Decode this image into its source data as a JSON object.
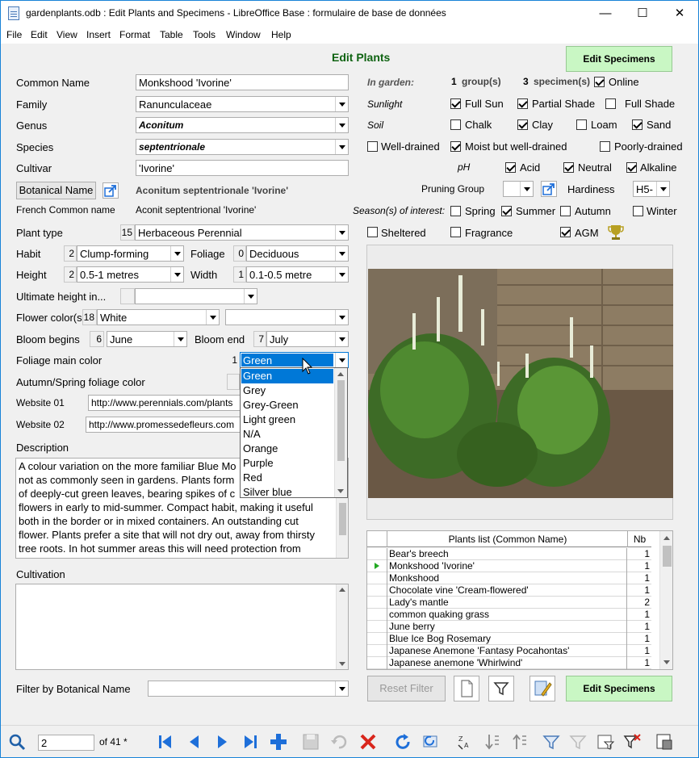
{
  "window": {
    "title": "gardenplants.odb : Edit Plants and Specimens - LibreOffice Base : formulaire de base de données",
    "minimize": "—",
    "maximize": "☐",
    "close": "✕"
  },
  "menu": [
    "File",
    "Edit",
    "View",
    "Insert",
    "Format",
    "Table",
    "Tools",
    "Window",
    "Help"
  ],
  "form": {
    "title": "Edit Plants",
    "edit_specimens_label": "Edit Specimens",
    "common_name_label": "Common Name",
    "common_name_value": "Monkshood 'Ivorine'",
    "family_label": "Family",
    "family_value": "Ranunculaceae",
    "genus_label": "Genus",
    "genus_value": "Aconitum",
    "species_label": "Species",
    "species_value": "septentrionale",
    "cultivar_label": "Cultivar",
    "cultivar_value": "'Ivorine'",
    "botanical_name_button": "Botanical Name",
    "botanical_name_value": "Aconitum septentrionale 'Ivorine'",
    "french_label": "French Common name",
    "french_value": "Aconit septentrional 'Ivorine'",
    "plant_type_label": "Plant type",
    "plant_type_num": "15",
    "plant_type_value": "Herbaceous Perennial",
    "habit_label": "Habit",
    "habit_num": "2",
    "habit_value": "Clump-forming",
    "foliage_label": "Foliage",
    "foliage_num": "0",
    "foliage_value": "Deciduous",
    "height_label": "Height",
    "height_num": "2",
    "height_value": "0.5-1 metres",
    "width_label": "Width",
    "width_num": "1",
    "width_value": "0.1-0.5 metre",
    "ultimate_label": "Ultimate height in...",
    "flower_label": "Flower color(s",
    "flower_num": "18",
    "flower_value": "White",
    "bloom_begins_label": "Bloom begins",
    "bloom_begins_num": "6",
    "bloom_begins_value": "June",
    "bloom_end_label": "Bloom end",
    "bloom_end_num": "7",
    "bloom_end_value": "July",
    "foliage_main_label": "Foliage main color",
    "foliage_main_num": "1",
    "foliage_main_value": "Green",
    "autumn_label": "Autumn/Spring foliage color",
    "website1_label": "Website 01",
    "website1_value": "http://www.perennials.com/plants",
    "website2_label": "Website 02",
    "website2_value": "http://www.promessedefleurs.com",
    "description_label": "Description",
    "description_lines": [
      "A colour variation on the more familiar Blue Mo",
      "not as commonly seen in gardens. Plants form",
      "of deeply-cut green leaves, bearing spikes of c",
      "flowers in early to mid-summer. Compact habit, making it useful",
      "both in the border or in mixed containers. An outstanding cut",
      "flower. Plants prefer a site that will not dry out, away from thirsty",
      "tree roots. In hot summer areas this will need protection from"
    ],
    "cultivation_label": "Cultivation",
    "filter_label": "Filter by Botanical Name",
    "dropdown_options": [
      "Green",
      "Grey",
      "Grey-Green",
      "Light green",
      "N/A",
      "Orange",
      "Purple",
      "Red",
      "Silver blue"
    ],
    "in_garden_label": "In garden:",
    "group_count": "1",
    "groups_label": "group(s)",
    "specimen_count": "3",
    "specimens_label": "specimen(s)",
    "online_label": "Online",
    "sunlight_label": "Sunlight",
    "full_sun": "Full Sun",
    "partial_shade": "Partial Shade",
    "full_shade": "Full Shade",
    "soil_label": "Soil",
    "chalk": "Chalk",
    "clay": "Clay",
    "loam": "Loam",
    "sand": "Sand",
    "well_drained": "Well-drained",
    "moist": "Moist but well-drained",
    "poorly": "Poorly-drained",
    "ph_label": "pH",
    "acid": "Acid",
    "neutral": "Neutral",
    "alkaline": "Alkaline",
    "pruning_label": "Pruning Group",
    "hardiness_label": "Hardiness",
    "hardiness_value": "H5-",
    "seasons_label": "Season(s) of interest:",
    "spring": "Spring",
    "summer": "Summer",
    "autumn": "Autumn",
    "winter": "Winter",
    "sheltered": "Sheltered",
    "fragrance": "Fragrance",
    "agm": "AGM",
    "grid_header_name": "Plants list (Common Name)",
    "grid_header_nb": "Nb",
    "reset_filter": "Reset Filter",
    "edit_specimens_bottom": "Edit Specimens"
  },
  "plants_list": [
    {
      "name": "Bear's breech",
      "nb": "1"
    },
    {
      "name": "Monkshood 'Ivorine'",
      "nb": "1"
    },
    {
      "name": "Monkshood",
      "nb": "1"
    },
    {
      "name": "Chocolate vine 'Cream-flowered'",
      "nb": "1"
    },
    {
      "name": "Lady's mantle",
      "nb": "2"
    },
    {
      "name": "common quaking grass",
      "nb": "1"
    },
    {
      "name": "June berry",
      "nb": "1"
    },
    {
      "name": "Blue Ice Bog Rosemary",
      "nb": "1"
    },
    {
      "name": "Japanese Anemone 'Fantasy Pocahontas'",
      "nb": "1"
    },
    {
      "name": "Japanese anemone 'Whirlwind'",
      "nb": "1"
    }
  ],
  "navigation": {
    "record_value": "2",
    "record_of": "of  41 *"
  },
  "colors": {
    "title_green": "#0f6312",
    "green_button": "#c9f7c4",
    "selection_blue": "#0078d7",
    "nav_blue": "#1e6fd9",
    "delete_red": "#d9261c"
  },
  "checkbox_states": {
    "online": true,
    "full_sun": true,
    "partial_shade": true,
    "full_shade": false,
    "chalk": false,
    "clay": true,
    "loam": false,
    "sand": true,
    "well_drained": false,
    "moist": true,
    "poorly": false,
    "acid": true,
    "neutral": true,
    "alkaline": true,
    "spring": false,
    "summer": true,
    "autumn": false,
    "winter": false,
    "sheltered": false,
    "fragrance": false,
    "agm": true
  }
}
